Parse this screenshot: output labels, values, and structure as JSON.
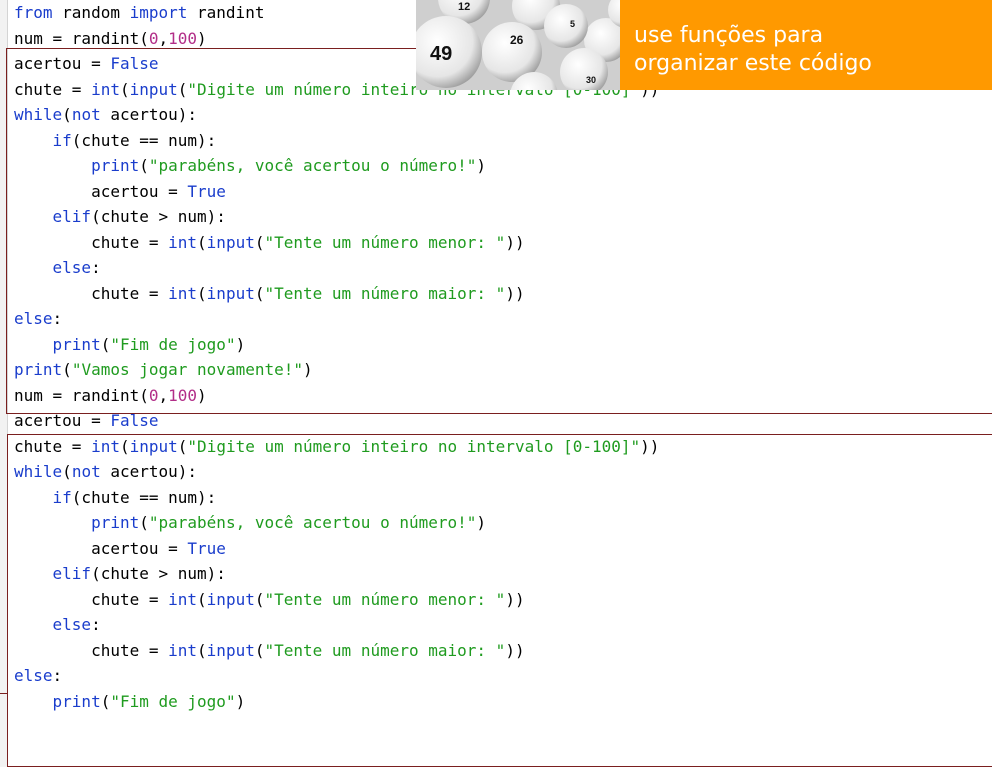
{
  "slide": {
    "instruction": "use funções para\norganizar este código",
    "lottery_numbers": [
      "12",
      "49",
      "26",
      "5",
      "30"
    ],
    "colors": {
      "banner": "#ff9900",
      "keyword": "#1a3dcc",
      "string": "#1f9b1f",
      "number": "#b22e88",
      "block_border": "#7a1f1f"
    }
  },
  "code": {
    "language": "python",
    "lines": [
      [
        [
          "kw",
          "from"
        ],
        [
          "txt",
          " random "
        ],
        [
          "kw",
          "import"
        ],
        [
          "txt",
          " randint"
        ]
      ],
      [
        [
          "txt",
          "num = randint("
        ],
        [
          "num",
          "0"
        ],
        [
          "txt",
          ","
        ],
        [
          "num",
          "100"
        ],
        [
          "txt",
          ")"
        ]
      ],
      [
        [
          "txt",
          "acertou = "
        ],
        [
          "kw",
          "False"
        ]
      ],
      [
        [
          "txt",
          "chute = "
        ],
        [
          "kw",
          "int"
        ],
        [
          "txt",
          "("
        ],
        [
          "kw",
          "input"
        ],
        [
          "txt",
          "("
        ],
        [
          "str",
          "\"Digite um número inteiro no intervalo [0-100]\""
        ],
        [
          "txt",
          "))"
        ]
      ],
      [
        [
          "kw",
          "while"
        ],
        [
          "txt",
          "("
        ],
        [
          "kw",
          "not"
        ],
        [
          "txt",
          " acertou):"
        ]
      ],
      [
        [
          "txt",
          "    "
        ],
        [
          "kw",
          "if"
        ],
        [
          "txt",
          "(chute == num):"
        ]
      ],
      [
        [
          "txt",
          "        "
        ],
        [
          "kw",
          "print"
        ],
        [
          "txt",
          "("
        ],
        [
          "str",
          "\"parabéns, você acertou o número!\""
        ],
        [
          "txt",
          ")"
        ]
      ],
      [
        [
          "txt",
          "        acertou = "
        ],
        [
          "kw",
          "True"
        ]
      ],
      [
        [
          "txt",
          "    "
        ],
        [
          "kw",
          "elif"
        ],
        [
          "txt",
          "(chute > num):"
        ]
      ],
      [
        [
          "txt",
          "        chute = "
        ],
        [
          "kw",
          "int"
        ],
        [
          "txt",
          "("
        ],
        [
          "kw",
          "input"
        ],
        [
          "txt",
          "("
        ],
        [
          "str",
          "\"Tente um número menor: \""
        ],
        [
          "txt",
          "))"
        ]
      ],
      [
        [
          "txt",
          "    "
        ],
        [
          "kw",
          "else"
        ],
        [
          "txt",
          ":"
        ]
      ],
      [
        [
          "txt",
          "        chute = "
        ],
        [
          "kw",
          "int"
        ],
        [
          "txt",
          "("
        ],
        [
          "kw",
          "input"
        ],
        [
          "txt",
          "("
        ],
        [
          "str",
          "\"Tente um número maior: \""
        ],
        [
          "txt",
          "))"
        ]
      ],
      [
        [
          "kw",
          "else"
        ],
        [
          "txt",
          ":"
        ]
      ],
      [
        [
          "txt",
          "    "
        ],
        [
          "kw",
          "print"
        ],
        [
          "txt",
          "("
        ],
        [
          "str",
          "\"Fim de jogo\""
        ],
        [
          "txt",
          ")"
        ]
      ],
      [
        [
          "kw",
          "print"
        ],
        [
          "txt",
          "("
        ],
        [
          "str",
          "\"Vamos jogar novamente!\""
        ],
        [
          "txt",
          ")"
        ]
      ],
      [
        [
          "txt",
          "num = randint("
        ],
        [
          "num",
          "0"
        ],
        [
          "txt",
          ","
        ],
        [
          "num",
          "100"
        ],
        [
          "txt",
          ")"
        ]
      ],
      [
        [
          "txt",
          "acertou = "
        ],
        [
          "kw",
          "False"
        ]
      ],
      [
        [
          "txt",
          "chute = "
        ],
        [
          "kw",
          "int"
        ],
        [
          "txt",
          "("
        ],
        [
          "kw",
          "input"
        ],
        [
          "txt",
          "("
        ],
        [
          "str",
          "\"Digite um número inteiro no intervalo [0-100]\""
        ],
        [
          "txt",
          "))"
        ]
      ],
      [
        [
          "kw",
          "while"
        ],
        [
          "txt",
          "("
        ],
        [
          "kw",
          "not"
        ],
        [
          "txt",
          " acertou):"
        ]
      ],
      [
        [
          "txt",
          "    "
        ],
        [
          "kw",
          "if"
        ],
        [
          "txt",
          "(chute == num):"
        ]
      ],
      [
        [
          "txt",
          "        "
        ],
        [
          "kw",
          "print"
        ],
        [
          "txt",
          "("
        ],
        [
          "str",
          "\"parabéns, você acertou o número!\""
        ],
        [
          "txt",
          ")"
        ]
      ],
      [
        [
          "txt",
          "        acertou = "
        ],
        [
          "kw",
          "True"
        ]
      ],
      [
        [
          "txt",
          "    "
        ],
        [
          "kw",
          "elif"
        ],
        [
          "txt",
          "(chute > num):"
        ]
      ],
      [
        [
          "txt",
          "        chute = "
        ],
        [
          "kw",
          "int"
        ],
        [
          "txt",
          "("
        ],
        [
          "kw",
          "input"
        ],
        [
          "txt",
          "("
        ],
        [
          "str",
          "\"Tente um número menor: \""
        ],
        [
          "txt",
          "))"
        ]
      ],
      [
        [
          "txt",
          "    "
        ],
        [
          "kw",
          "else"
        ],
        [
          "txt",
          ":"
        ]
      ],
      [
        [
          "txt",
          "        chute = "
        ],
        [
          "kw",
          "int"
        ],
        [
          "txt",
          "("
        ],
        [
          "kw",
          "input"
        ],
        [
          "txt",
          "("
        ],
        [
          "str",
          "\"Tente um número maior: \""
        ],
        [
          "txt",
          "))"
        ]
      ],
      [
        [
          "kw",
          "else"
        ],
        [
          "txt",
          ":"
        ]
      ],
      [
        [
          "txt",
          "    "
        ],
        [
          "kw",
          "print"
        ],
        [
          "txt",
          "("
        ],
        [
          "str",
          "\"Fim de jogo\""
        ],
        [
          "txt",
          ")"
        ]
      ]
    ]
  }
}
